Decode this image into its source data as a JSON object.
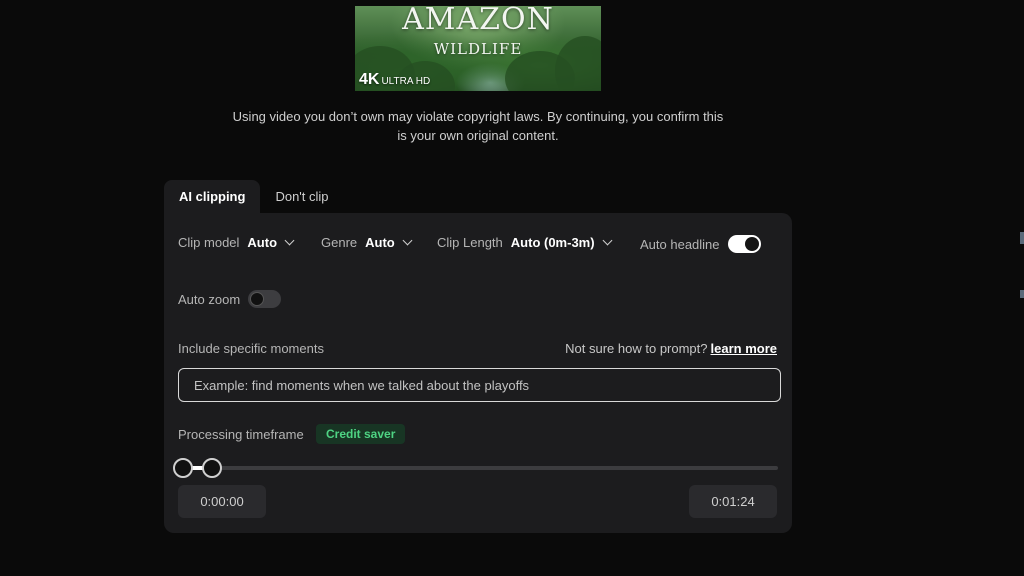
{
  "thumbnail": {
    "title": "AMAZON",
    "subtitle": "WILDLIFE",
    "badge": "4K",
    "badge_sub": "ULTRA HD"
  },
  "notice": "Using video you don’t own may violate copyright laws. By continuing, you confirm this is your own original content.",
  "tabs": [
    {
      "label": "AI clipping",
      "active": true
    },
    {
      "label": "Don't clip",
      "active": false
    }
  ],
  "options": {
    "clip_model": {
      "label": "Clip model",
      "value": "Auto"
    },
    "genre": {
      "label": "Genre",
      "value": "Auto"
    },
    "clip_length": {
      "label": "Clip Length",
      "value": "Auto (0m-3m)"
    },
    "auto_headline": {
      "label": "Auto headline",
      "on": true
    },
    "auto_zoom": {
      "label": "Auto zoom",
      "on": false
    }
  },
  "moments": {
    "label": "Include specific moments",
    "help_text": "Not sure how to prompt?",
    "help_link": "learn more",
    "placeholder": "Example: find moments when we talked about the playoffs"
  },
  "timeframe": {
    "label": "Processing timeframe",
    "badge": "Credit saver",
    "start": "0:00:00",
    "end": "0:01:24"
  },
  "colors": {
    "background": "#0a0a0a",
    "panel": "#1c1c1e",
    "badge_text": "#4ed383",
    "badge_bg": "#183524"
  }
}
